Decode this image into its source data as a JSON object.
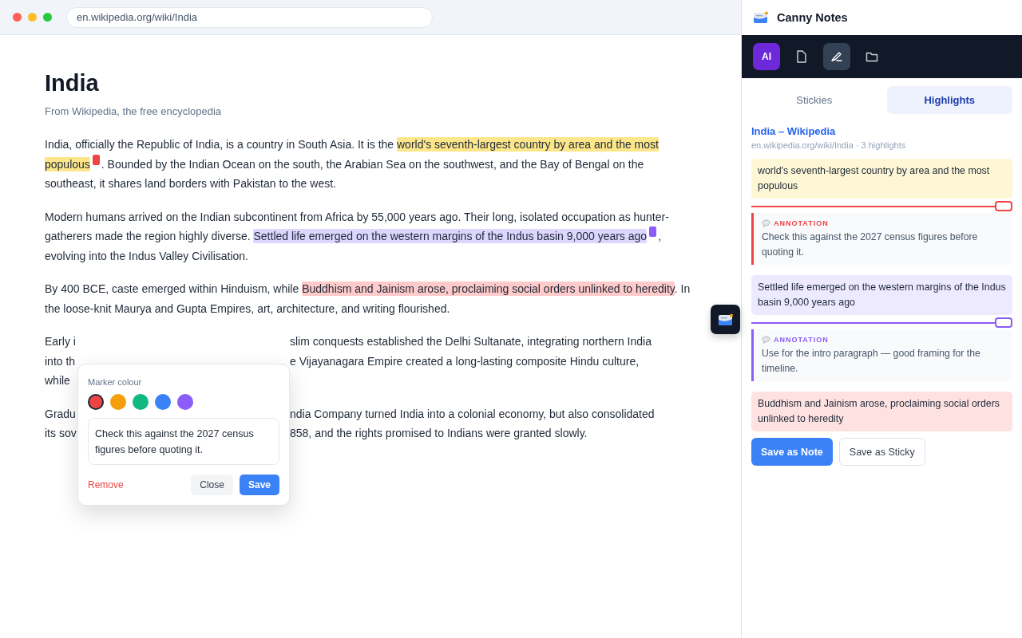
{
  "browser": {
    "url": "en.wikipedia.org/wiki/India"
  },
  "article": {
    "title": "India",
    "subtitle": "From Wikipedia, the free encyclopedia",
    "paragraphs": [
      {
        "kind": "flow",
        "segments": [
          {
            "kind": "text",
            "text": "India, officially the Republic of India, is a country in South Asia. It is the "
          },
          {
            "kind": "highlight",
            "text": "world's seventh-largest country by area and the most populous",
            "color": "#fde68a",
            "marker": {
              "color": "#ef4444"
            }
          },
          {
            "kind": "text",
            "text": ". Bounded by the Indian Ocean on the south, the Arabian Sea on the southwest, and the Bay of Bengal on the southeast, it shares land borders with Pakistan to the west."
          }
        ]
      },
      {
        "kind": "flow",
        "segments": [
          {
            "kind": "text",
            "text": "Modern humans arrived on the Indian subcontinent from Africa by 55,000 years ago. Their long, isolated occupation as hunter-gatherers made the region highly diverse. "
          },
          {
            "kind": "highlight",
            "text": "Settled life emerged on the western margins of the Indus basin 9,000 years ago",
            "color": "#ddd6fe",
            "marker": {
              "color": "#8b5cf6"
            }
          },
          {
            "kind": "text",
            "text": ", evolving into the Indus Valley Civilisation."
          }
        ]
      },
      {
        "kind": "flow",
        "segments": [
          {
            "kind": "text",
            "text": "By 400 BCE, caste emerged within Hinduism, while "
          },
          {
            "kind": "highlight",
            "text": "Buddhism and Jainism arose, proclaiming social orders unlinked to heredity",
            "color": "#fecaca"
          },
          {
            "kind": "text",
            "text": ". In the loose-knit Maurya and Gupta Empires, art, architecture, and writing flourished."
          }
        ]
      },
      {
        "kind": "covered",
        "lines": [
          {
            "left": "Early i",
            "right": "slim conquests established the Delhi Sultanate, integrating northern India"
          },
          {
            "left": "into th",
            "right": "e Vijayanagara Empire created a long-lasting composite Hindu culture,"
          },
          {
            "left": "while"
          }
        ]
      },
      {
        "kind": "covered",
        "lines": [
          {
            "left": "Gradu",
            "right": "ndia Company turned India into a colonial economy, but also consolidated"
          },
          {
            "left": "its sov",
            "right": "858, and the rights promised to Indians were granted slowly."
          }
        ]
      }
    ]
  },
  "popover": {
    "label": "Marker colour",
    "swatches": [
      {
        "color": "#ef4444",
        "selected": true
      },
      {
        "color": "#f59e0b",
        "selected": false
      },
      {
        "color": "#10b981",
        "selected": false
      },
      {
        "color": "#3b82f6",
        "selected": false
      },
      {
        "color": "#8b5cf6",
        "selected": false
      }
    ],
    "note": "Check this against the 2027 census figures before quoting it.",
    "remove": "Remove",
    "close": "Close",
    "save": "Save"
  },
  "sidebar": {
    "title": "Canny Notes",
    "tools": [
      {
        "kind": "ai",
        "label": "AI"
      },
      {
        "kind": "file",
        "selected": false
      },
      {
        "kind": "highlighter",
        "selected": true
      },
      {
        "kind": "folder",
        "selected": false
      }
    ],
    "tabs": [
      {
        "label": "Stickies",
        "selected": false
      },
      {
        "label": "Highlights",
        "selected": true
      }
    ],
    "source": {
      "title": "India – Wikipedia",
      "meta": "en.wikipedia.org/wiki/India · 3 highlights"
    },
    "highlights": [
      {
        "text": "world's seventh-largest country by area and the most populous",
        "color": "#fef7d6",
        "annotation": {
          "label": "ANNOTATION",
          "text": "Check this against the 2027 census figures before quoting it.",
          "color": "#ef4444"
        }
      },
      {
        "text": "Settled life emerged on the western margins of the Indus basin 9,000 years ago",
        "color": "#ede9fe",
        "annotation": {
          "label": "ANNOTATION",
          "text": "Use for the intro paragraph — good framing for the timeline.",
          "color": "#8b5cf6"
        }
      },
      {
        "text": "Buddhism and Jainism arose, proclaiming social orders unlinked to heredity",
        "color": "#fee2e2"
      }
    ],
    "actions": [
      "Save as Note",
      "Save as Sticky"
    ]
  }
}
